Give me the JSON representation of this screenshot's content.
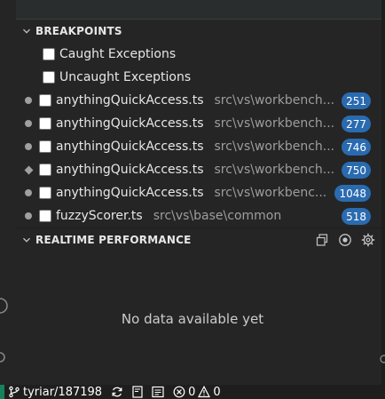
{
  "breakpoints": {
    "header": "BREAKPOINTS",
    "exceptions": [
      {
        "label": "Caught Exceptions"
      },
      {
        "label": "Uncaught Exceptions"
      }
    ],
    "items": [
      {
        "file": "anythingQuickAccess.ts",
        "path": "src\\vs\\workbench...",
        "line": "251",
        "marker": "circle"
      },
      {
        "file": "anythingQuickAccess.ts",
        "path": "src\\vs\\workbench...",
        "line": "277",
        "marker": "circle"
      },
      {
        "file": "anythingQuickAccess.ts",
        "path": "src\\vs\\workbench...",
        "line": "746",
        "marker": "circle"
      },
      {
        "file": "anythingQuickAccess.ts",
        "path": "src\\vs\\workbench...",
        "line": "750",
        "marker": "diamond"
      },
      {
        "file": "anythingQuickAccess.ts",
        "path": "src\\vs\\workbenc...",
        "line": "1048",
        "marker": "circle"
      },
      {
        "file": "fuzzyScorer.ts",
        "path": "src\\vs\\base\\common",
        "line": "518",
        "marker": "circle"
      }
    ]
  },
  "performance": {
    "header": "REALTIME PERFORMANCE",
    "empty_message": "No data available yet",
    "actions": [
      "copy-icon",
      "record-icon",
      "gear-icon"
    ]
  },
  "status_bar": {
    "branch": "tyriar/187198",
    "errors": "0",
    "warnings": "0"
  },
  "colors": {
    "badge": "#2a6bb0",
    "sidebar_bg": "#252526",
    "editor_bg": "#1e1e1e"
  }
}
